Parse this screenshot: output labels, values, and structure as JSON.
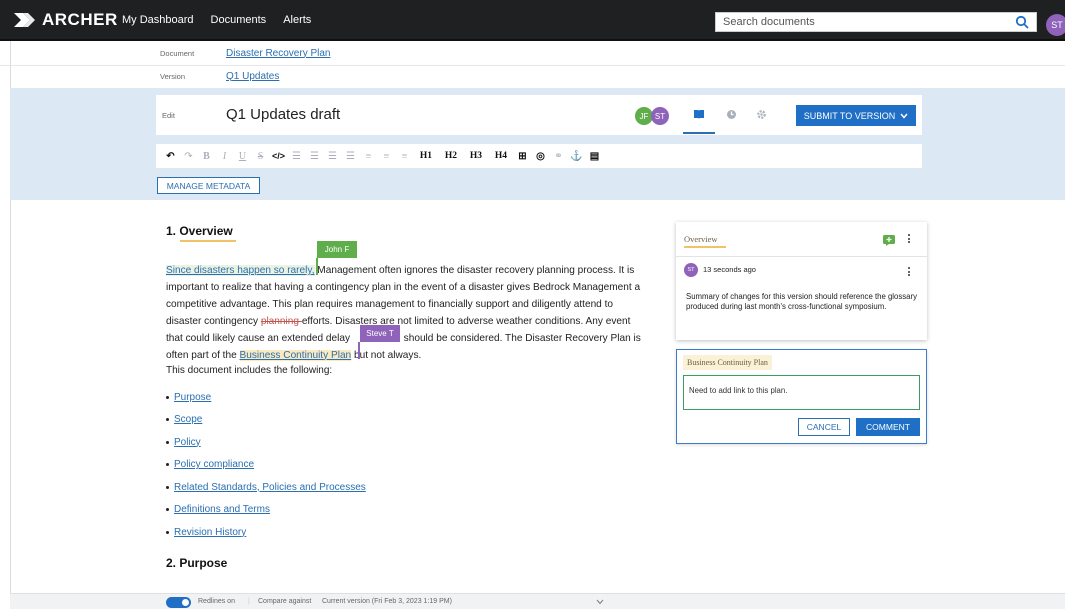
{
  "nav": {
    "brand": "ARCHER",
    "items": [
      "My Dashboard",
      "Documents",
      "Alerts"
    ],
    "search_placeholder": "Search documents",
    "user_initials": "ST"
  },
  "meta": {
    "document_label": "Document",
    "document_value": "Disaster Recovery Plan",
    "version_label": "Version",
    "version_value": "Q1 Updates"
  },
  "editor": {
    "edit_label": "Edit",
    "title": "Q1 Updates draft",
    "collaborators": [
      {
        "initials": "JF",
        "color": "#5fae4b"
      },
      {
        "initials": "ST",
        "color": "#8e63b9"
      }
    ],
    "submit_label": "SUBMIT TO VERSION",
    "manage_metadata_label": "MANAGE METADATA",
    "toolbar": {
      "h1": "H1",
      "h2": "H2",
      "h3": "H3",
      "h4": "H4"
    }
  },
  "document": {
    "heading1": "1. Overview",
    "para": {
      "l1_link": "Since disasters happen so rarely,",
      "l1_rest": " Management often ignores the disaster recovery planning process. It is",
      "l2": "important to realize that having a contingency plan in the event of a disaster gives Bedrock Management a",
      "l3": "competitive advantage. This plan requires management to financially support and diligently attend to",
      "l4_pre": "disaster contingency ",
      "l4_strike": "planning ",
      "l4_post": "efforts. Disasters are not limited to adverse weather conditions. Any event",
      "l5_pre": "that could likely cause an extended delay ",
      "l5_post": " should be considered. The Disaster Recovery Plan is",
      "l6_pre": "often part of the ",
      "l6_link": "Business Continuity Plan",
      "l6_post": " but not always."
    },
    "tags": {
      "john": "John F",
      "steve": "Steve T"
    },
    "intro": "This document includes the following:",
    "bullets": [
      "Purpose",
      "Scope",
      "Policy",
      "Policy compliance",
      "Related Standards, Policies and Processes",
      "Definitions and Terms",
      "Revision History"
    ],
    "heading2": "2. Purpose"
  },
  "comments": {
    "thread_title": "Overview",
    "author_initials": "ST",
    "time": "13 seconds ago",
    "text": "Summary of changes for this version should reference the glossary produced during last month's cross-functional symposium.",
    "new_title": "Business Continuity Plan",
    "new_text": "Need to add link to this plan.",
    "cancel_label": "CANCEL",
    "comment_label": "COMMENT"
  },
  "footer": {
    "redlines_label": "Redlines on",
    "compare_label": "Compare against",
    "compare_value": "Current version (Fri Feb 3, 2023 1:19 PM)"
  }
}
